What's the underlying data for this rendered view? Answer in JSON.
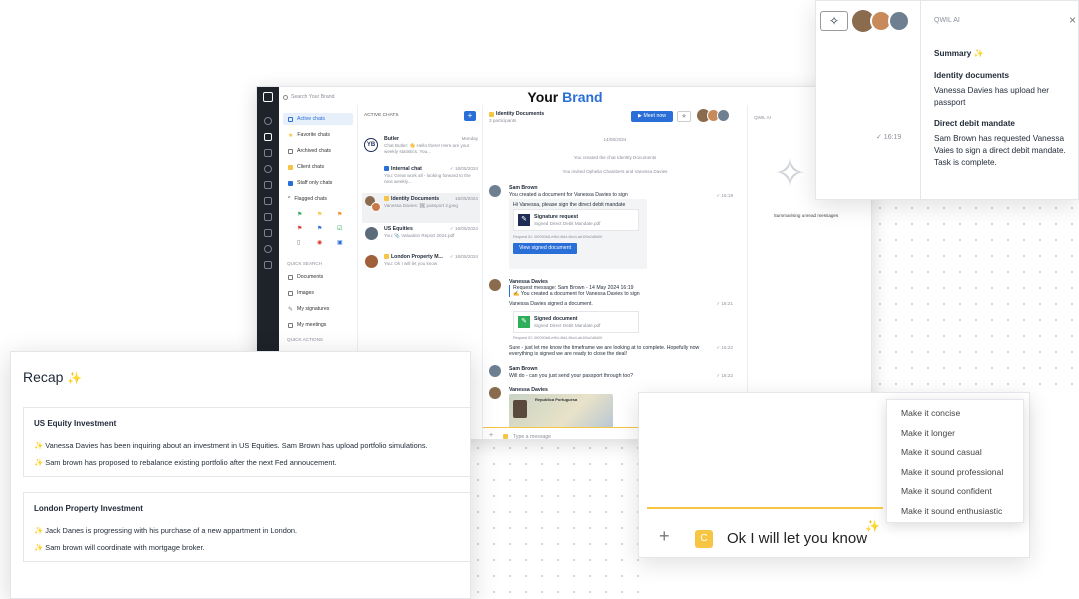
{
  "colors": {
    "accent": "#2a6fd8",
    "sparkle": "#f5c543",
    "rail": "#1e2229"
  },
  "search": {
    "placeholder": "Search Your Brand"
  },
  "brand": {
    "prefix": "Your",
    "name": "Brand"
  },
  "nav": {
    "items": [
      "Active chats",
      "Favorite chats",
      "Archived chats",
      "Client chats",
      "Staff only chats",
      "Flagged chats"
    ],
    "quick_search_label": "QUICK SEARCH",
    "quick_search_items": [
      "Documents",
      "Images",
      "My signatures",
      "My meetings"
    ],
    "quick_actions_label": "QUICK ACTIONS"
  },
  "chatlist": {
    "header": "ACTIVE CHATS",
    "add_label": "+",
    "chats": [
      {
        "name": "Butler",
        "time": "Monday",
        "preview": "Chat Butler: 👋 Hello there! Here are your weekly statistics. You..."
      },
      {
        "name": "Internal chat",
        "time": "✓ 16/05/2024",
        "preview": "You: Great work all - looking forward to the next weekly..."
      },
      {
        "name": "Identity Documents",
        "time": "16/05/2024",
        "preview": "Vanessa Davies: 🖼 passport 2.jpeg"
      },
      {
        "name": "US Equities",
        "time": "✓ 16/05/2024",
        "preview": "You: 📎 Valuation Report 2024.pdf"
      },
      {
        "name": "London Property M...",
        "time": "✓ 16/05/2024",
        "preview": "You: Ok I will let you know"
      }
    ]
  },
  "thread": {
    "title": "Identity Documents",
    "participants": "3 participants",
    "meet_label": "Meet now",
    "date": "14/05/2024",
    "sys1": "You created the chat Identity Documents",
    "sys2": "You invited Ophelia Chambers and Vanessa Davies",
    "m1_sender": "Sam Brown",
    "m1_line1": "You created a document for Vanessa Davies to sign",
    "m1_line2": "Hi Vanessa, please sign the direct debit mandate",
    "m1_time": "✓ 16:19",
    "doc1_title": "Signature request",
    "doc1_sub": "Signed Direct Debit Mandate.pdf",
    "doc1_req": "Request ID: 0f0050b8-e9fd-4fd4-8bc4-ab1f9a2d8d00",
    "doc1_button": "View signed document",
    "m2_sender": "Vanessa Davies",
    "m2_quote1": "Request message: Sam Brown - 14 May 2024 16:19",
    "m2_quote2": "✍ You created a document for Vanessa Davies to sign",
    "m2_line": "Vanessa Davies signed a document.",
    "m2_time": "✓ 16:21",
    "doc2_title": "Signed document",
    "doc2_sub": "Signed Direct Debit Mandate.pdf",
    "doc2_req": "Request ID: 0f0050b8-e9fd-4fd4-8bc4-ab1f9a2d8d00",
    "m3_line": "Sure - just let me know the timeframe we are looking at to complete. Hopefully now everything is signed we are ready to close the deal!",
    "m3_time": "✓ 16:22",
    "m4_sender": "Sam Brown",
    "m4_line": "Will do - can you just send your passport through too?",
    "m4_time": "✓ 16:22",
    "m5_sender": "Vanessa Davies",
    "passport_text": "Republica Portuguesa",
    "input_placeholder": "Type a message"
  },
  "qwil_pane": {
    "title": "QWIL AI",
    "status": "Summarising unread messages"
  },
  "qwil_popup": {
    "title": "QWIL AI",
    "close": "×",
    "time": "✓ 16:19",
    "summary_label": "Summary",
    "sections": [
      {
        "heading": "Identity documents",
        "body": "Vanessa Davies has upload her passport"
      },
      {
        "heading": "Direct debit mandate",
        "body": "Sam Brown has requested Vanessa Vaies to sign a direct debit mandate. Task is complete."
      }
    ]
  },
  "recap": {
    "title": "Recap",
    "cards": [
      {
        "heading": "US Equity Investment",
        "items": [
          "Vanessa Davies has been inquiring about an investment in US Equities. Sam Brown has upload portfolio simulations.",
          "Sam brown has proposed to rebalance existing portfolio after the next Fed annoucement."
        ]
      },
      {
        "heading": "London Property Investment",
        "items": [
          "Jack Danes is progressing with his purchase of a new appartment in London.",
          "Sam brown will coordinate with mortgage broker."
        ]
      }
    ]
  },
  "rewrite": {
    "options": [
      "Make it concise",
      "Make it longer",
      "Make it sound casual",
      "Make it sound professional",
      "Make it sound confident",
      "Make it sound enthusiastic"
    ],
    "plus": "+",
    "badge": "C",
    "message": "Ok I will let you know"
  },
  "icons": [
    "compose-icon",
    "search-icon",
    "chat-icon",
    "star-icon",
    "archive-icon",
    "flag-icon",
    "document-icon",
    "image-icon",
    "pen-icon",
    "video-icon",
    "sparkle-icon",
    "close-icon",
    "plus-icon",
    "camera-icon"
  ]
}
